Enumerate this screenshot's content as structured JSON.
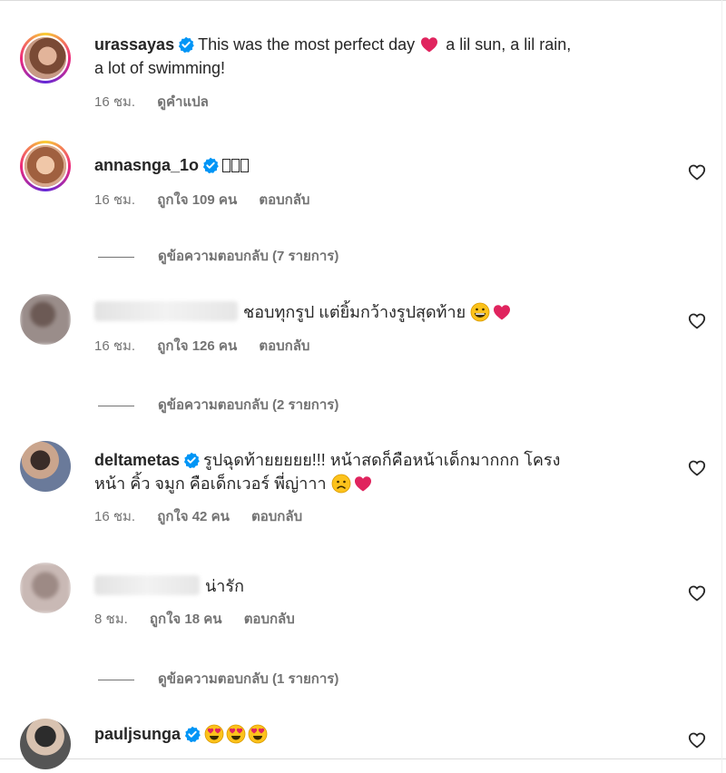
{
  "comments": [
    {
      "username": "urassayas",
      "text_parts": [
        "This was the most perfect day",
        "a lil sun, a lil rain,",
        "a lot of swimming!"
      ],
      "time": "16 ชม.",
      "translate": "ดูคำแปล"
    },
    {
      "username": "annasnga_1o",
      "text": "",
      "time": "16 ชม.",
      "likes": "ถูกใจ 109 คน",
      "reply": "ตอบกลับ",
      "view_replies": "ดูข้อความตอบกลับ (7 รายการ)"
    },
    {
      "username": "",
      "text": "ชอบทุกรูป แต่ยิ้มกว้างรูปสุดท้าย",
      "time": "16 ชม.",
      "likes": "ถูกใจ 126 คน",
      "reply": "ตอบกลับ",
      "view_replies": "ดูข้อความตอบกลับ (2 รายการ)"
    },
    {
      "username": "deltametas",
      "text_line1": "รูปฉุดท้ายยยยย!!! หน้าสดก็คือหน้าเด็กมากกก โครง",
      "text_line2": "หน้า คิ้ว จมูก คือเด็กเวอร์ พี่ญ่าาา",
      "time": "16 ชม.",
      "likes": "ถูกใจ 42 คน",
      "reply": "ตอบกลับ"
    },
    {
      "username": "",
      "text": "น่ารัก",
      "time": "8 ชม.",
      "likes": "ถูกใจ 18 คน",
      "reply": "ตอบกลับ",
      "view_replies": "ดูข้อความตอบกลับ (1 รายการ)"
    },
    {
      "username": "pauljsunga",
      "text": ""
    }
  ],
  "colors": {
    "verified": "#0095f6",
    "meta_text": "#737373",
    "text": "#262626"
  },
  "icons": [
    "verified-icon",
    "heart-outline-icon",
    "avatar"
  ]
}
